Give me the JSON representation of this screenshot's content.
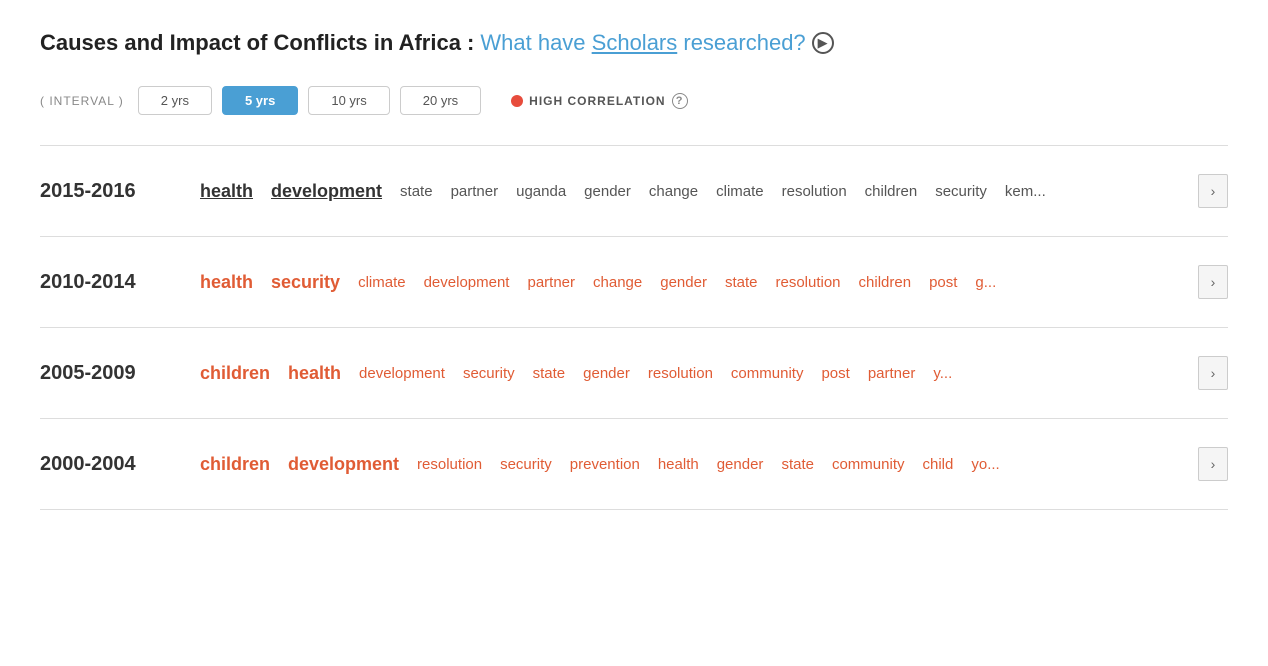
{
  "title": {
    "static": "Causes and Impact of Conflicts in Africa : ",
    "link_what": "What have ",
    "link_scholars": "Scholars",
    "link_researched": " researched?",
    "info_icon": "▶"
  },
  "interval": {
    "label": "( INTERVAL )",
    "options": [
      {
        "id": "2yrs",
        "label": "2 yrs",
        "active": false
      },
      {
        "id": "5yrs",
        "label": "5 yrs",
        "active": true
      },
      {
        "id": "10yrs",
        "label": "10 yrs",
        "active": false
      },
      {
        "id": "20yrs",
        "label": "20 yrs",
        "active": false
      }
    ],
    "high_correlation_label": "HIGH CORRELATION"
  },
  "periods": [
    {
      "id": "2015-2016",
      "label": "2015-2016",
      "keywords": [
        {
          "text": "health",
          "style": "black"
        },
        {
          "text": "development",
          "style": "black"
        },
        {
          "text": "state",
          "style": "small"
        },
        {
          "text": "partner",
          "style": "small"
        },
        {
          "text": "uganda",
          "style": "small"
        },
        {
          "text": "gender",
          "style": "small"
        },
        {
          "text": "change",
          "style": "small"
        },
        {
          "text": "climate",
          "style": "small"
        },
        {
          "text": "resolution",
          "style": "small"
        },
        {
          "text": "children",
          "style": "small"
        },
        {
          "text": "security",
          "style": "small"
        },
        {
          "text": "kem...",
          "style": "small"
        }
      ]
    },
    {
      "id": "2010-2014",
      "label": "2010-2014",
      "keywords": [
        {
          "text": "health",
          "style": "red"
        },
        {
          "text": "security",
          "style": "red"
        },
        {
          "text": "climate",
          "style": "red"
        },
        {
          "text": "development",
          "style": "red"
        },
        {
          "text": "partner",
          "style": "red"
        },
        {
          "text": "change",
          "style": "red"
        },
        {
          "text": "gender",
          "style": "red"
        },
        {
          "text": "state",
          "style": "red"
        },
        {
          "text": "resolution",
          "style": "red"
        },
        {
          "text": "children",
          "style": "red"
        },
        {
          "text": "post",
          "style": "red"
        },
        {
          "text": "g...",
          "style": "red"
        }
      ]
    },
    {
      "id": "2005-2009",
      "label": "2005-2009",
      "keywords": [
        {
          "text": "children",
          "style": "red"
        },
        {
          "text": "health",
          "style": "red"
        },
        {
          "text": "development",
          "style": "red"
        },
        {
          "text": "security",
          "style": "red"
        },
        {
          "text": "state",
          "style": "red"
        },
        {
          "text": "gender",
          "style": "red"
        },
        {
          "text": "resolution",
          "style": "red"
        },
        {
          "text": "community",
          "style": "red"
        },
        {
          "text": "post",
          "style": "red"
        },
        {
          "text": "partner",
          "style": "red"
        },
        {
          "text": "y...",
          "style": "red"
        }
      ]
    },
    {
      "id": "2000-2004",
      "label": "2000-2004",
      "keywords": [
        {
          "text": "children",
          "style": "red"
        },
        {
          "text": "development",
          "style": "red"
        },
        {
          "text": "resolution",
          "style": "red"
        },
        {
          "text": "security",
          "style": "red"
        },
        {
          "text": "prevention",
          "style": "red"
        },
        {
          "text": "health",
          "style": "red"
        },
        {
          "text": "gender",
          "style": "red"
        },
        {
          "text": "state",
          "style": "red"
        },
        {
          "text": "community",
          "style": "red"
        },
        {
          "text": "child",
          "style": "red"
        },
        {
          "text": "yo...",
          "style": "red"
        }
      ]
    }
  ],
  "more_button_label": "›"
}
